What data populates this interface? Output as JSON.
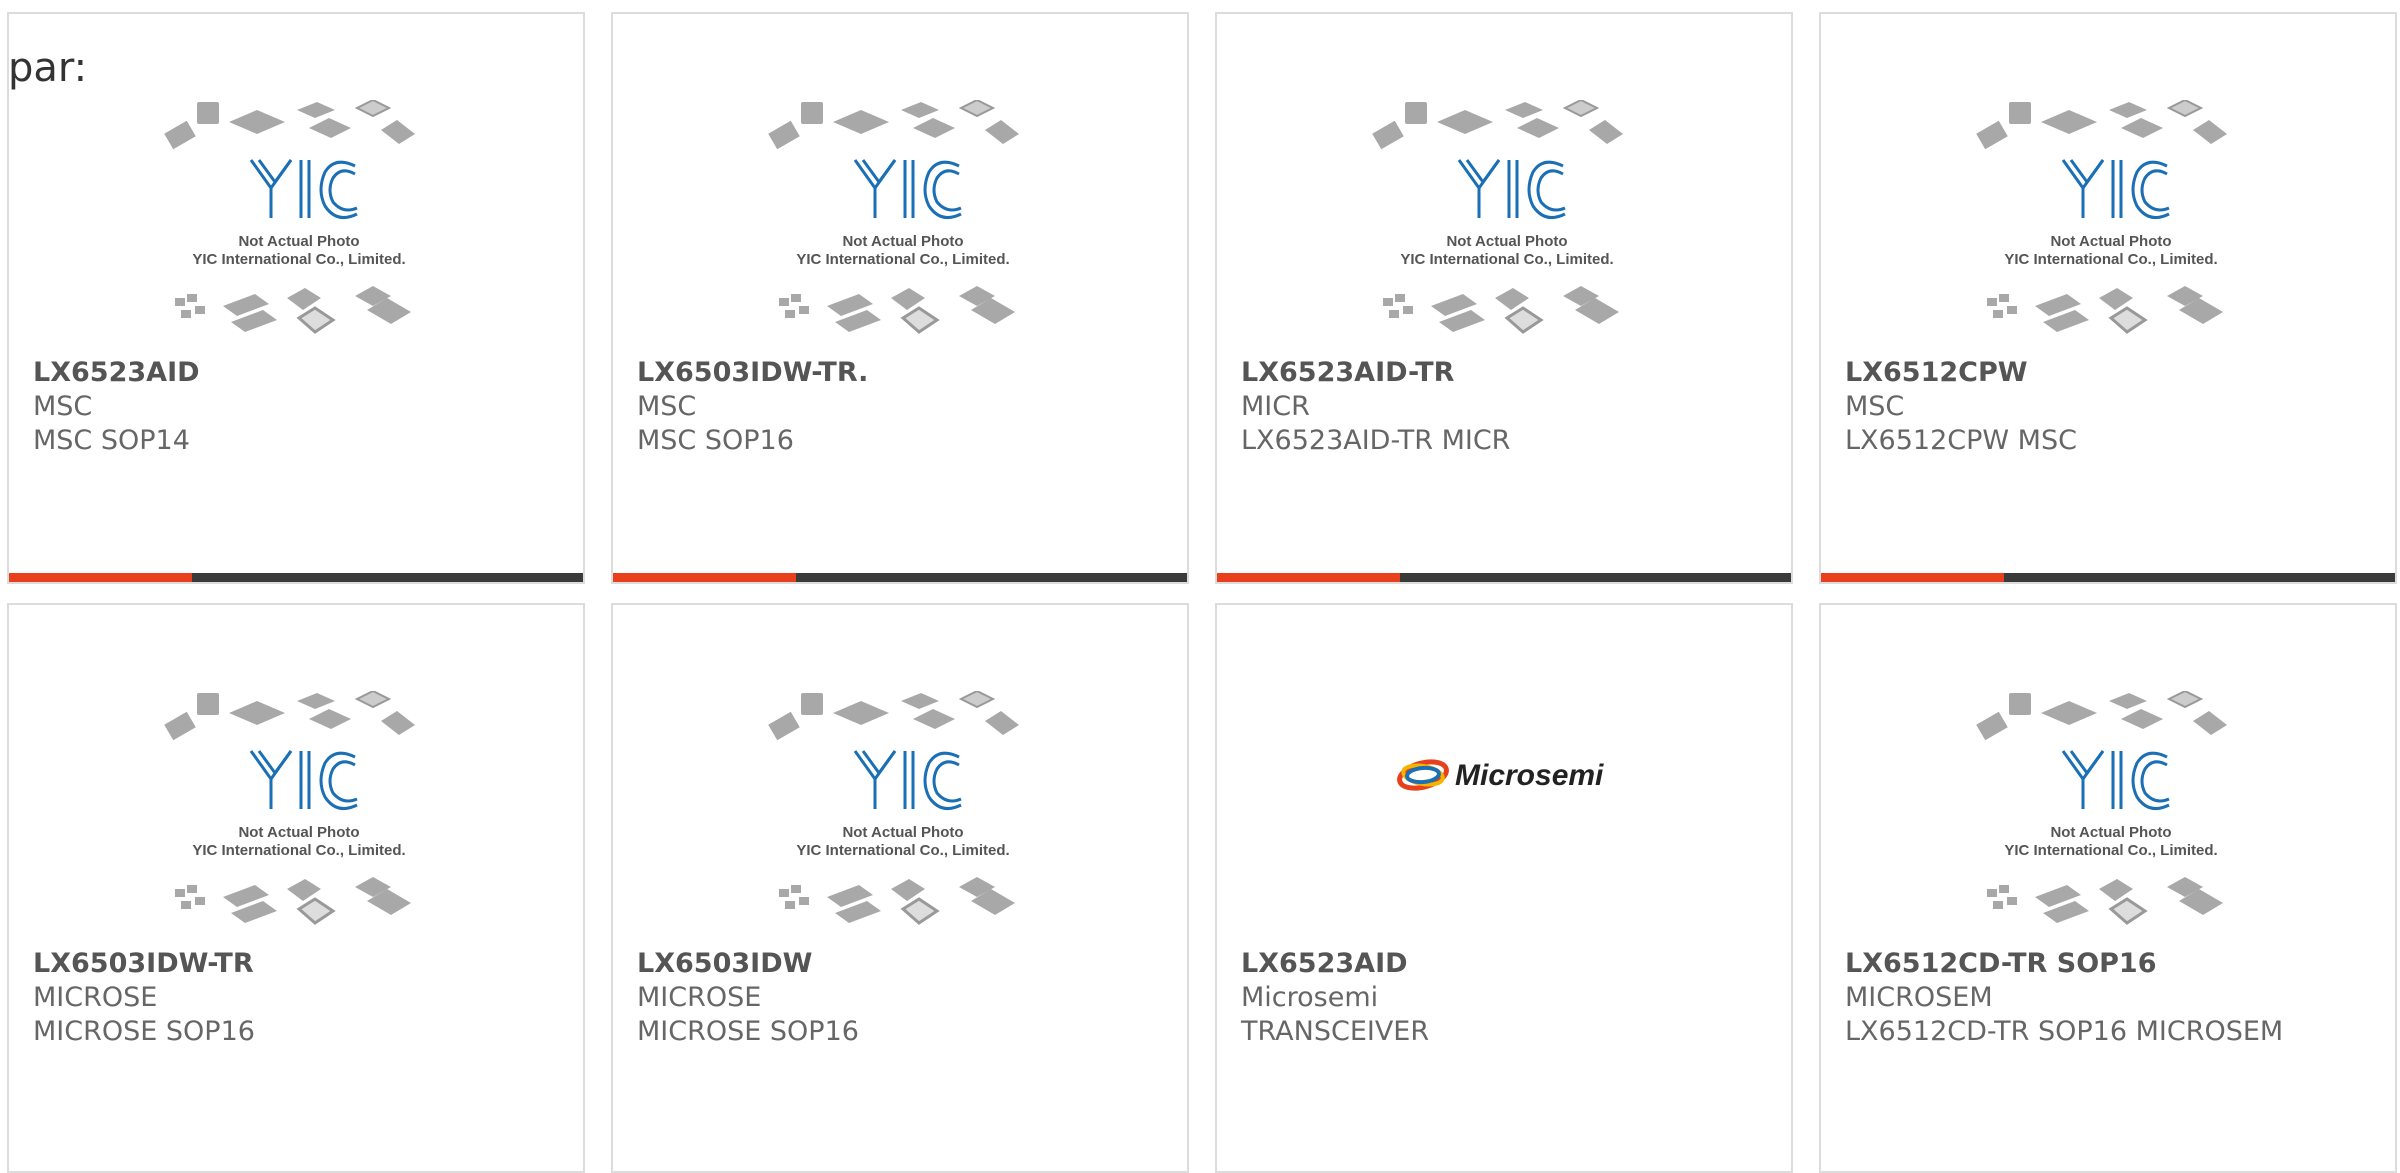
{
  "header": {
    "label": "par:"
  },
  "placeholder": {
    "logo_text": "YIC",
    "line1": "Not Actual Photo",
    "line2": "YIC International Co., Limited."
  },
  "microsemi_logo_text": "Microsemi",
  "colors": {
    "accent": "#e8401c",
    "bar": "#3a3a3a",
    "border": "#dcdcdc",
    "logo_blue": "#1a6fb5"
  },
  "products": [
    {
      "part": "LX6523AID",
      "maker": "MSC",
      "desc": "MSC SOP14",
      "image": "placeholder"
    },
    {
      "part": "LX6503IDW-TR.",
      "maker": "MSC",
      "desc": "MSC SOP16",
      "image": "placeholder"
    },
    {
      "part": "LX6523AID-TR",
      "maker": "MICR",
      "desc": "LX6523AID-TR MICR",
      "image": "placeholder"
    },
    {
      "part": "LX6512CPW",
      "maker": "MSC",
      "desc": "LX6512CPW MSC",
      "image": "placeholder"
    },
    {
      "part": "LX6503IDW-TR",
      "maker": "MICROSE",
      "desc": "MICROSE SOP16",
      "image": "placeholder"
    },
    {
      "part": "LX6503IDW",
      "maker": "MICROSE",
      "desc": "MICROSE SOP16",
      "image": "placeholder"
    },
    {
      "part": "LX6523AID",
      "maker": "Microsemi",
      "desc": "TRANSCEIVER",
      "image": "microsemi-logo"
    },
    {
      "part": "LX6512CD-TR SOP16",
      "maker": "MICROSEM",
      "desc": "LX6512CD-TR SOP16 MICROSEM",
      "image": "placeholder"
    }
  ]
}
